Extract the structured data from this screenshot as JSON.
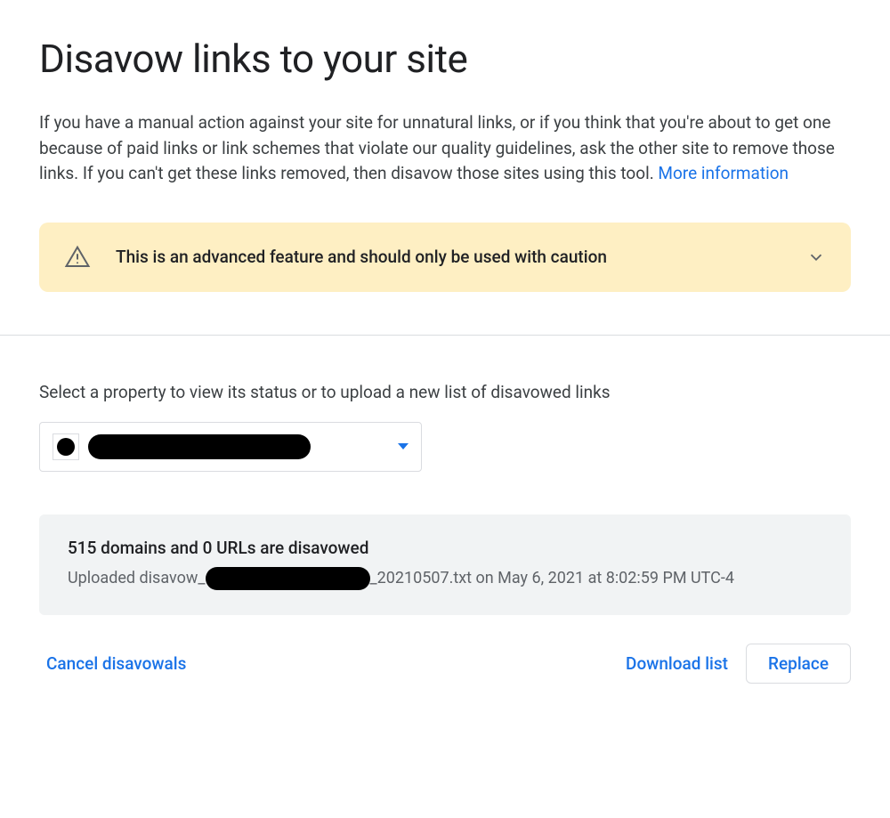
{
  "page_title": "Disavow links to your site",
  "description_text": "If you have a manual action against your site for unnatural links, or if you think that you're about to get one because of paid links or link schemes that violate our quality guidelines, ask the other site to remove those links. If you can't get these links removed, then disavow those sites using this tool. ",
  "more_info_label": "More information",
  "warning_text": "This is an advanced feature and should only be used with caution",
  "select_property_label": "Select a property to view its status or to upload a new list of disavowed links",
  "status": {
    "headline": "515 domains and 0 URLs are disavowed",
    "upload_prefix": "Uploaded disavow_",
    "upload_suffix": "_20210507.txt on May 6, 2021 at 8:02:59 PM UTC-4"
  },
  "actions": {
    "cancel_label": "Cancel disavowals",
    "download_label": "Download list",
    "replace_label": "Replace"
  }
}
